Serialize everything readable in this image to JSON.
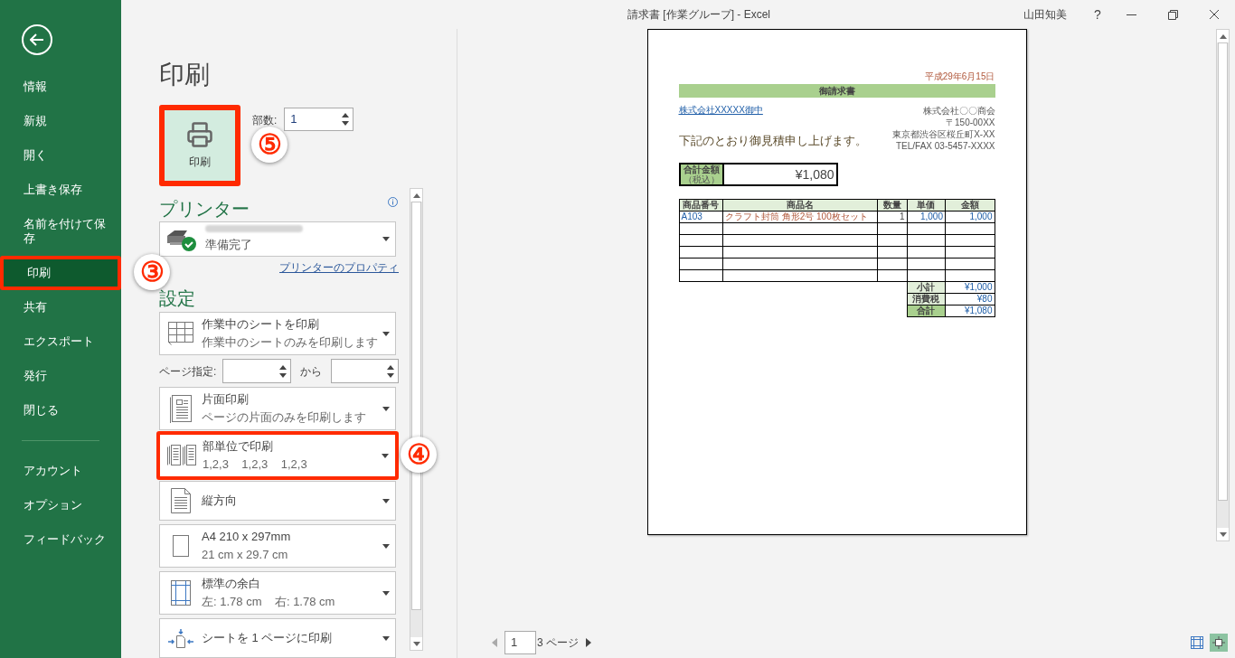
{
  "window": {
    "title": "請求書 [作業グループ] - Excel",
    "user": "山田知美",
    "help": "?"
  },
  "sidebar": {
    "items": [
      {
        "label": "情報",
        "selected": false,
        "highlighted": false
      },
      {
        "label": "新規",
        "selected": false,
        "highlighted": false
      },
      {
        "label": "開く",
        "selected": false,
        "highlighted": false
      },
      {
        "label": "上書き保存",
        "selected": false,
        "highlighted": false
      },
      {
        "label": "名前を付けて保存",
        "selected": false,
        "highlighted": false
      },
      {
        "label": "印刷",
        "selected": true,
        "highlighted": true,
        "callout": "③"
      },
      {
        "label": "共有",
        "selected": false,
        "highlighted": false
      },
      {
        "label": "エクスポート",
        "selected": false,
        "highlighted": false
      },
      {
        "label": "発行",
        "selected": false,
        "highlighted": false
      },
      {
        "label": "閉じる",
        "selected": false,
        "highlighted": false
      }
    ],
    "footer_items": [
      {
        "label": "アカウント",
        "selected": false,
        "highlighted": false
      },
      {
        "label": "オプション",
        "selected": false,
        "highlighted": false
      },
      {
        "label": "フィードバック",
        "selected": false,
        "highlighted": false
      }
    ]
  },
  "print": {
    "title": "印刷",
    "print_button": {
      "label": "印刷",
      "highlighted": true,
      "callout": "⑤"
    },
    "copies": {
      "label": "部数:",
      "value": "1"
    }
  },
  "printer": {
    "heading": "プリンター",
    "status": "準備完了",
    "properties_link": "プリンターのプロパティ"
  },
  "settings": {
    "heading": "設定",
    "items": [
      {
        "kind": "option",
        "title": "作業中のシートを印刷",
        "subtitle": "作業中のシートのみを印刷します",
        "highlighted": false
      },
      {
        "kind": "range",
        "label": "ページ指定:",
        "to": "から"
      },
      {
        "kind": "option",
        "title": "片面印刷",
        "subtitle": "ページの片面のみを印刷します",
        "highlighted": false
      },
      {
        "kind": "option",
        "title": "部単位で印刷",
        "subtitle": "1,2,3    1,2,3    1,2,3",
        "highlighted": true,
        "callout": "④"
      },
      {
        "kind": "option",
        "title": "縦方向",
        "highlighted": false
      },
      {
        "kind": "option",
        "title": "A4 210 x 297mm",
        "subtitle": "21 cm x 29.7 cm",
        "highlighted": false
      },
      {
        "kind": "option",
        "title": "標準の余白",
        "subtitle": "左: 1.78 cm    右: 1.78 cm",
        "highlighted": false
      },
      {
        "kind": "option",
        "title": "シートを 1 ページに印刷",
        "highlighted": false
      }
    ]
  },
  "preview": {
    "invoice": {
      "date": "平成29年6月15日",
      "title": "御請求書",
      "recipient": "株式会社XXXXX御中",
      "sender": [
        "株式会社〇〇商会",
        "〒150-00XX",
        "東京都渋谷区桜丘町X-XX",
        "TEL/FAX 03-5457-XXXX"
      ],
      "message": "下記のとおり御見積申し上げます。",
      "total_label": "合計金額",
      "total_sublabel": "（税込）",
      "total": "¥1,080",
      "columns": [
        "商品番号",
        "商品名",
        "数量",
        "単価",
        "金額"
      ],
      "rows": [
        [
          "A103",
          "クラフト封筒 角形2号 100枚セット",
          "1",
          "1,000",
          "1,000"
        ]
      ],
      "summary": [
        {
          "label": "小計",
          "value": "¥1,000"
        },
        {
          "label": "消費税",
          "value": "¥80"
        },
        {
          "label": "合計",
          "value": "¥1,080"
        }
      ]
    },
    "page_nav": {
      "current": "1",
      "total": "3 ページ"
    },
    "view_buttons": [
      {
        "selected": false
      },
      {
        "selected": true
      }
    ]
  }
}
